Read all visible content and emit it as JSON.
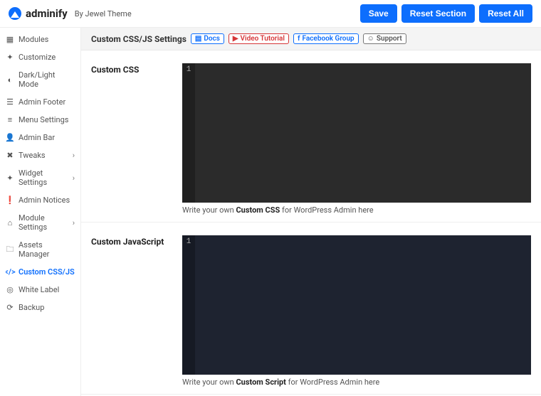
{
  "header": {
    "brand": "adminify",
    "byline": "By Jewel Theme",
    "buttons": {
      "save": "Save",
      "reset_section": "Reset Section",
      "reset_all": "Reset All"
    }
  },
  "sidebar": {
    "items": [
      {
        "label": "Modules",
        "icon": "modules-icon",
        "expandable": false,
        "active": false
      },
      {
        "label": "Customize",
        "icon": "customize-icon",
        "expandable": false,
        "active": false
      },
      {
        "label": "Dark/Light Mode",
        "icon": "theme-mode-icon",
        "expandable": false,
        "active": false
      },
      {
        "label": "Admin Footer",
        "icon": "footer-icon",
        "expandable": false,
        "active": false
      },
      {
        "label": "Menu Settings",
        "icon": "menu-icon",
        "expandable": false,
        "active": false
      },
      {
        "label": "Admin Bar",
        "icon": "admin-bar-icon",
        "expandable": false,
        "active": false
      },
      {
        "label": "Tweaks",
        "icon": "tweaks-icon",
        "expandable": true,
        "active": false
      },
      {
        "label": "Widget Settings",
        "icon": "widget-icon",
        "expandable": true,
        "active": false
      },
      {
        "label": "Admin Notices",
        "icon": "notices-icon",
        "expandable": false,
        "active": false
      },
      {
        "label": "Module Settings",
        "icon": "module-settings-icon",
        "expandable": true,
        "active": false
      },
      {
        "label": "Assets Manager",
        "icon": "assets-icon",
        "expandable": false,
        "active": false
      },
      {
        "label": "Custom CSS/JS",
        "icon": "code-icon",
        "expandable": false,
        "active": true
      },
      {
        "label": "White Label",
        "icon": "white-label-icon",
        "expandable": false,
        "active": false
      },
      {
        "label": "Backup",
        "icon": "backup-icon",
        "expandable": false,
        "active": false
      }
    ]
  },
  "section": {
    "title": "Custom CSS/JS Settings",
    "chips": {
      "docs": "Docs",
      "video": "Video Tutorial",
      "facebook": "Facebook Group",
      "support": "Support"
    }
  },
  "panels": {
    "css": {
      "label": "Custom CSS",
      "line1": "1",
      "value": "",
      "hint_pre": "Write your own ",
      "hint_bold": "Custom CSS",
      "hint_post": " for WordPress Admin here"
    },
    "js": {
      "label": "Custom JavaScript",
      "line1": "1",
      "value": "",
      "hint_pre": "Write your own ",
      "hint_bold": "Custom Script",
      "hint_post": " for WordPress Admin here"
    }
  },
  "colors": {
    "accent": "#0d6efd",
    "danger": "#d63638"
  }
}
